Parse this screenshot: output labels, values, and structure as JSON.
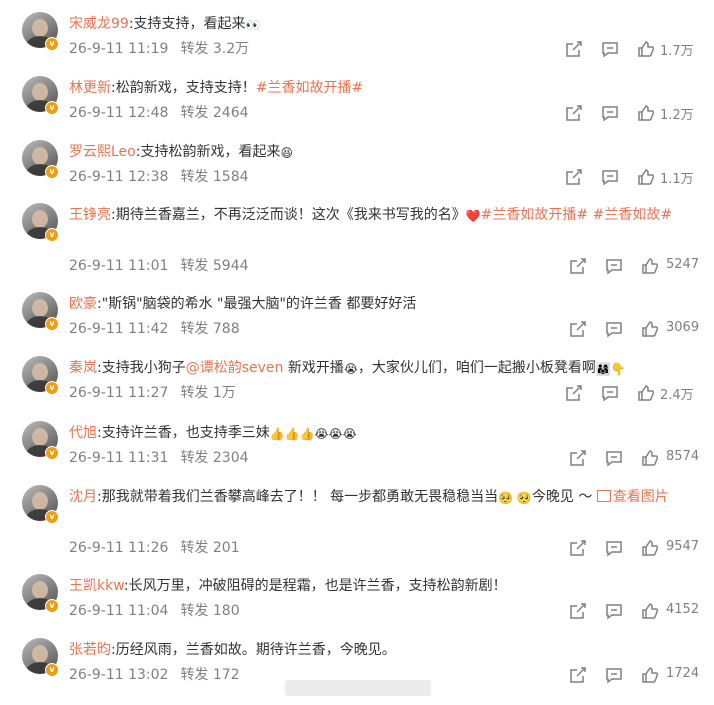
{
  "comments": [
    {
      "name": "宋威龙99",
      "colon": ":",
      "text": "支持支持，看起来",
      "emoji": "👀",
      "date": "26-9-11 11:19",
      "repost_label": "转发",
      "repost": "3.2万",
      "likes": "1.7万"
    },
    {
      "name": "林更新",
      "colon": ":",
      "text": "松韵新戏，支持支持！",
      "topic1": "#兰香如故开播#",
      "date": "26-9-11 12:48",
      "repost_label": "转发",
      "repost": "2464",
      "likes": "1.2万"
    },
    {
      "name": "罗云熙Leo",
      "colon": ":",
      "text": "支持松韵新戏，看起来",
      "emoji": "😆",
      "date": "26-9-11 12:38",
      "repost_label": "转发",
      "repost": "1584",
      "likes": "1.1万"
    },
    {
      "name": "王铮亮",
      "colon": ":",
      "text": "期待兰香嘉兰，不再泛泛而谈！这次《我来书写我的名》",
      "emoji": "❤️",
      "topic1": "#兰香如故开播#",
      "topic2": "#兰香如故#",
      "date": "26-9-11 11:01",
      "repost_label": "转发",
      "repost": "5944",
      "likes": "5247"
    },
    {
      "name": "欧豪",
      "colon": ":",
      "text": "\"斯锅\"脑袋的希水 \"最强大脑\"的许兰香 都要好好活",
      "date": "26-9-11 11:42",
      "repost_label": "转发",
      "repost": "788",
      "likes": "3069"
    },
    {
      "name": "秦岚",
      "colon": ":",
      "text": "支持我小狗子",
      "mention": "@谭松韵seven",
      "text2": " 新戏开播",
      "emoji": "😭",
      "text3": "，大家伙儿们，咱们一起搬小板凳看啊",
      "emoji2": "👨‍👩‍👧👇",
      "date": "26-9-11 11:27",
      "repost_label": "转发",
      "repost": "1万",
      "likes": "2.4万"
    },
    {
      "name": "代旭",
      "colon": ":",
      "text": "支持许兰香，也支持季三妹",
      "emoji": "👍👍👍😭😭😭",
      "date": "26-9-11 11:31",
      "repost_label": "转发",
      "repost": "2304",
      "likes": "8574"
    },
    {
      "name": "沈月",
      "colon": ":",
      "text": "那我就带着我们兰香攀高峰去了！！ 每一步都勇敢无畏稳稳当当",
      "emoji": "🥺 🥺",
      "text2": "今晚见 ～",
      "view_image": "查看图片",
      "date": "26-9-11 11:26",
      "repost_label": "转发",
      "repost": "201",
      "likes": "9547"
    },
    {
      "name": "王凯kkw",
      "colon": ":",
      "text": "长风万里，冲破阻碍的是程霜，也是许兰香，支持松韵新剧！",
      "date": "26-9-11 11:04",
      "repost_label": "转发",
      "repost": "180",
      "likes": "4152"
    },
    {
      "name": "张若昀",
      "colon": ":",
      "text": "历经风雨，兰香如故。期待许兰香，今晚见。",
      "date": "26-9-11 13:02",
      "repost_label": "转发",
      "repost": "172",
      "likes": "1724"
    }
  ],
  "icons": {
    "share": "share-icon",
    "comment": "comment-icon",
    "like": "thumbs-up-icon",
    "verified": "verified-badge-icon"
  },
  "colors": {
    "username": "#eb7350",
    "meta": "#808080",
    "text": "#333333",
    "badge": "#f09d12"
  }
}
